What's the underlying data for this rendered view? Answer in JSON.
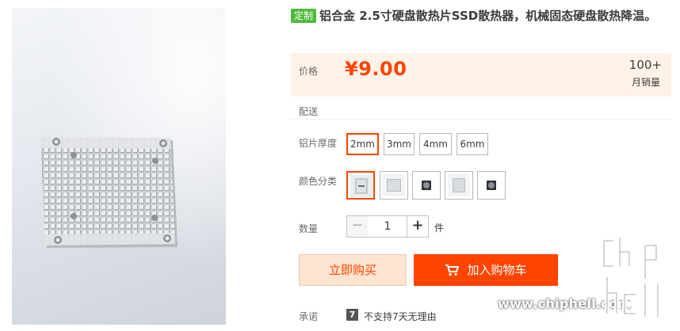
{
  "product": {
    "badge": "定制",
    "title": "铝合金 2.5寸硬盘散热片SSD散热器，机械固态硬盘散热降温。"
  },
  "price": {
    "label": "价格",
    "value": "¥9.00",
    "sales_count": "100+",
    "sales_label": "月销量"
  },
  "delivery": {
    "label": "配送"
  },
  "thickness": {
    "label": "铝片厚度",
    "options": [
      "2mm",
      "3mm",
      "4mm",
      "6mm"
    ],
    "selected": "2mm"
  },
  "color": {
    "label": "颜色分类",
    "swatch_icons": [
      "heatsink-photo-icon",
      "heatsink-plain-icon",
      "fan-icon",
      "heatsink-plain-icon",
      "fan-icon"
    ],
    "selected_index": 0
  },
  "quantity": {
    "label": "数量",
    "minus": "−",
    "value": "1",
    "plus": "+",
    "unit": "件"
  },
  "actions": {
    "buy_now": "立即购买",
    "add_to_cart": "加入购物车"
  },
  "promise": {
    "label": "承诺",
    "icon_text": "7",
    "text": "不支持7天无理由"
  },
  "watermark": {
    "url": "www.chiphell.com",
    "logo": "chiphell"
  },
  "colors": {
    "accent": "#ff4400",
    "price_bg": "#fff2e8",
    "badge": "#4fbb3c",
    "buy_bg": "#ffe4d0"
  }
}
